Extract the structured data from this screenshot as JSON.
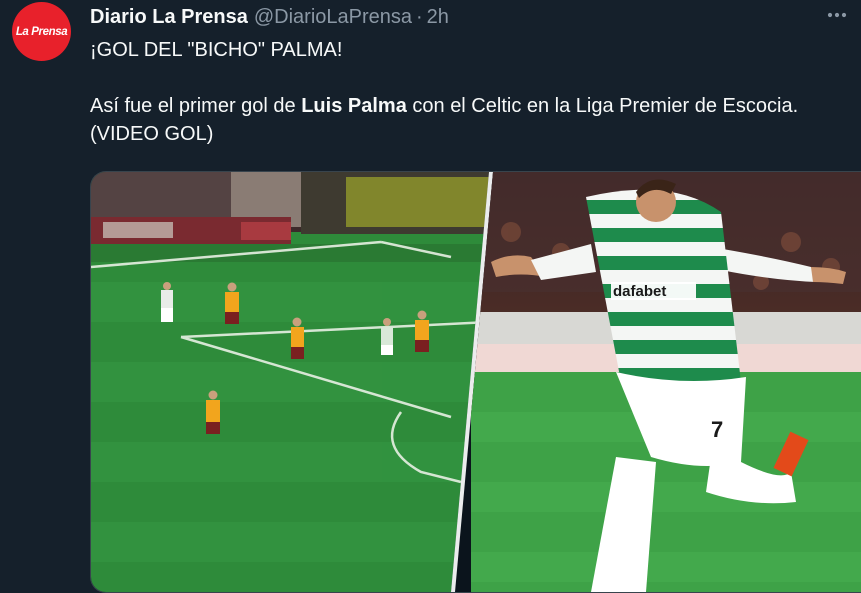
{
  "account": {
    "avatar_text": "La Prensa",
    "display_name": "Diario La Prensa",
    "handle": "@DiarioLaPrensa",
    "separator": "·",
    "time": "2h"
  },
  "tweet": {
    "line1": "¡GOL DEL \"BICHO\" PALMA!",
    "line2_before": "Así fue el primer gol de ",
    "line2_bold": "Luis Palma",
    "line2_after": " con el Celtic en la Liga Premier de Escocia. (VIDEO GOL)"
  },
  "media": {
    "jersey_sponsor": "dafabet",
    "shirt_number": "7",
    "colors": {
      "pitch": "#2f8a3c",
      "celtic_green": "#1e8b4c",
      "opponent_amber": "#f2a51d",
      "brand_red": "#e8212b"
    }
  },
  "icons": {
    "more": "more-horizontal-icon"
  }
}
